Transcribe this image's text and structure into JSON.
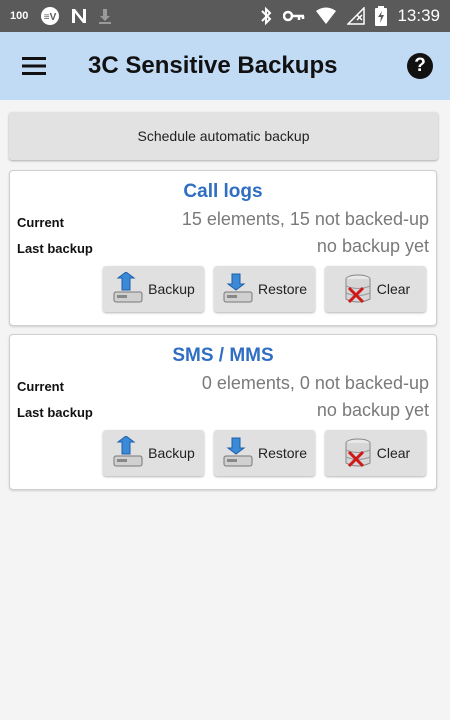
{
  "status_bar": {
    "battery_level": "100",
    "time": "13:39",
    "icons": [
      "battery-level-icon",
      "vpn-icon",
      "n-notification-icon",
      "download-icon",
      "bluetooth-icon",
      "key-icon",
      "wifi-icon",
      "signal-icon",
      "battery-icon"
    ]
  },
  "app_bar": {
    "title": "3C Sensitive Backups",
    "menu_icon": "hamburger-menu-icon",
    "help_icon": "help-icon"
  },
  "schedule": {
    "label": "Schedule automatic backup"
  },
  "cards": [
    {
      "title": "Call logs",
      "current_label": "Current",
      "current_value": "15 elements, 15 not backed-up",
      "last_backup_label": "Last backup",
      "last_backup_value": "no backup yet",
      "buttons": {
        "backup": "Backup",
        "restore": "Restore",
        "clear": "Clear"
      }
    },
    {
      "title": "SMS / MMS",
      "current_label": "Current",
      "current_value": "0 elements, 0 not backed-up",
      "last_backup_label": "Last backup",
      "last_backup_value": "no backup yet",
      "buttons": {
        "backup": "Backup",
        "restore": "Restore",
        "clear": "Clear"
      }
    }
  ],
  "colors": {
    "app_bar": "#c2dbf5",
    "card_title": "#2f6ec2",
    "status_bar": "#5a5a5a"
  }
}
